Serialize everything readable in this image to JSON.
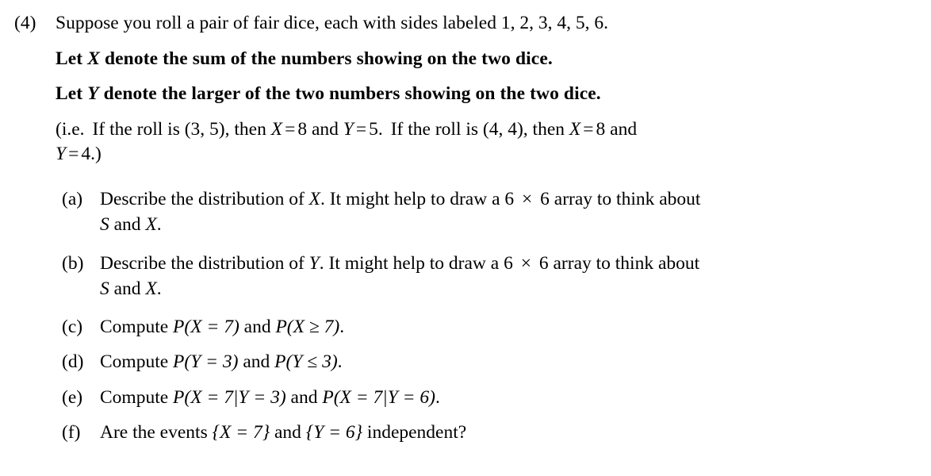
{
  "problem": {
    "number": "(4)",
    "stem": "Suppose you roll a pair of fair dice, each with sides labeled 1, 2, 3, 4, 5, 6.",
    "bold_lines": [
      {
        "pre": "Let ",
        "var": "X",
        "post": " denote the sum of the numbers showing on the two dice."
      },
      {
        "pre": "Let ",
        "var": "Y",
        "post": " denote the larger of the two numbers showing on the two dice."
      }
    ],
    "example": {
      "line1": {
        "open": "(i.e.",
        "seg1": "If the roll is (3, 5), then ",
        "math1_var": "X",
        "math1_eq": "=",
        "math1_val": "8",
        "seg2": " and ",
        "math2_var": "Y",
        "math2_eq": "=",
        "math2_val": "5.",
        "seg3": "If the roll is (4, 4), then ",
        "math3_var": "X",
        "math3_eq": "=",
        "math3_val": "8",
        "seg4": " and"
      },
      "line2": {
        "math_var": "Y",
        "math_eq": "=",
        "math_val": "4.)"
      }
    },
    "subitems": [
      {
        "label": "(a)",
        "text_1": "Describe the distribution of ",
        "var_1": "X",
        "text_2": ". It might help to draw a 6 ",
        "times": "×",
        "text_3": " 6 array to think about",
        "cont_var_1": "S",
        "cont_text_1": " and ",
        "cont_var_2": "X",
        "cont_text_2": "."
      },
      {
        "label": "(b)",
        "text_1": "Describe the distribution of ",
        "var_1": "Y",
        "text_2": ". It might help to draw a 6 ",
        "times": "×",
        "text_3": " 6 array to think about",
        "cont_var_1": "S",
        "cont_text_1": " and ",
        "cont_var_2": "X",
        "cont_text_2": "."
      },
      {
        "label": "(c)",
        "lead": "Compute ",
        "expr_1": "P(X = 7)",
        "joiner": " and ",
        "expr_2": "P(X ≥ 7)",
        "tail": "."
      },
      {
        "label": "(d)",
        "lead": "Compute ",
        "expr_1": "P(Y = 3)",
        "joiner": " and ",
        "expr_2": "P(Y ≤ 3)",
        "tail": "."
      },
      {
        "label": "(e)",
        "lead": "Compute ",
        "expr_1": "P(X = 7|Y = 3)",
        "joiner": " and ",
        "expr_2": "P(X = 7|Y = 6)",
        "tail": "."
      },
      {
        "label": "(f)",
        "lead": "Are the events ",
        "expr_1": "{X = 7}",
        "joiner": " and ",
        "expr_2": "{Y = 6}",
        "tail": " independent?"
      }
    ]
  },
  "symbols": {
    "equals": "=",
    "geq": "≥",
    "leq": "≤",
    "times": "×",
    "mid": "|",
    "brace_open": "{",
    "brace_close": "}",
    "paren_open": "(",
    "paren_close": ")"
  },
  "colors": {
    "text": "#000000",
    "background": "#ffffff"
  }
}
